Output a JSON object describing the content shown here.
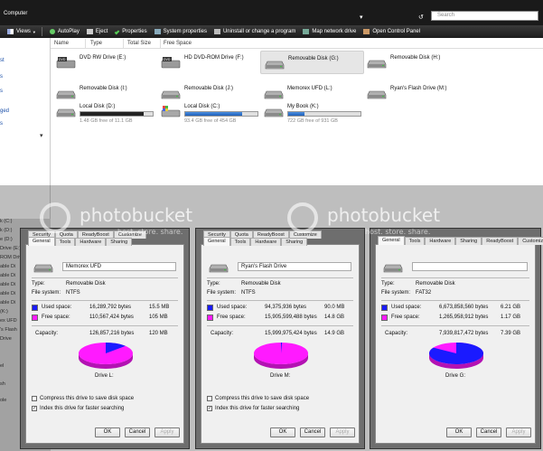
{
  "titlebar": {
    "breadcrumb": "Computer",
    "nav_up": "▾",
    "nav_back": "↺",
    "search_placeholder": "Search"
  },
  "toolbar": {
    "items": [
      "Views",
      "AutoPlay",
      "Eject",
      "Properties",
      "System properties",
      "Uninstall or change a program",
      "Map network drive",
      "Open Control Panel"
    ]
  },
  "leftpane": {
    "fragments": [
      "st",
      "s",
      "s",
      "ged",
      "s"
    ],
    "lower_items": [
      "k (C:)",
      "k (D:)",
      "e (D:)",
      "Drive (E:)",
      "ROM Drive (F:)",
      "able Di",
      "able Di",
      "able Di",
      "able Di",
      "able Di",
      "(K:)",
      "ex UFD",
      "'s Flash",
      "Drive",
      "el",
      "sh",
      "ole"
    ]
  },
  "columns": [
    "Name",
    "Type",
    "Total Size",
    "Free Space"
  ],
  "drives": [
    {
      "label": "DVD RW Drive (E:)",
      "icon": "dvd-drive-icon"
    },
    {
      "label": "HD DVD-ROM Drive (F:)",
      "icon": "dvd-drive-icon"
    },
    {
      "label": "Removable Disk (G:)",
      "icon": "removable-disk-icon",
      "selected": true
    },
    {
      "label": "Removable Disk (H:)",
      "icon": "removable-disk-icon"
    },
    {
      "label": "Removable Disk (I:)",
      "icon": "removable-disk-icon"
    },
    {
      "label": "Removable Disk (J:)",
      "icon": "removable-disk-icon"
    },
    {
      "label": "Memorex UFD (L:)",
      "icon": "removable-disk-icon"
    },
    {
      "label": "Ryan's Flash Drive (M:)",
      "icon": "removable-disk-icon"
    },
    {
      "label": "Local Disk (D:)",
      "icon": "hard-disk-icon",
      "free": "1.48 GB free of 11.1 GB",
      "used_fraction": 0.87
    },
    {
      "label": "Local Disk (C:)",
      "icon": "windows-disk-icon",
      "free": "93.4 GB free of 454 GB",
      "used_fraction": 0.79
    },
    {
      "label": "My Book (K:)",
      "icon": "hard-disk-icon",
      "free": "722 GB free of 931 GB",
      "used_fraction": 0.22
    }
  ],
  "dialogs": [
    {
      "tabs_top": [
        "Security",
        "Quota",
        "ReadyBoost",
        "Customize"
      ],
      "tabs": [
        "General",
        "Tools",
        "Hardware",
        "Sharing"
      ],
      "name": "Memorex UFD",
      "type_label": "Type:",
      "type": "Removable Disk",
      "fs_label": "File system:",
      "fs": "NTFS",
      "used_label": "Used space:",
      "used_bytes": "16,289,792 bytes",
      "used_h": "15.5 MB",
      "used_fraction": 0.13,
      "free_label": "Free space:",
      "free_bytes": "110,567,424 bytes",
      "free_h": "105 MB",
      "cap_label": "Capacity:",
      "cap_bytes": "126,857,216 bytes",
      "cap_h": "120 MB",
      "drive_caption": "Drive L:",
      "compress": "Compress this drive to save disk space",
      "index": "Index this drive for faster searching",
      "index_checked": true,
      "ok": "OK",
      "cancel": "Cancel",
      "apply": "Apply"
    },
    {
      "tabs_top": [
        "Security",
        "Quota",
        "ReadyBoost",
        "Customize"
      ],
      "tabs": [
        "General",
        "Tools",
        "Hardware",
        "Sharing"
      ],
      "name": "Ryan's Flash Drive",
      "type_label": "Type:",
      "type": "Removable Disk",
      "fs_label": "File system:",
      "fs": "NTFS",
      "used_label": "Used space:",
      "used_bytes": "94,375,936 bytes",
      "used_h": "90.0 MB",
      "used_fraction": 0.006,
      "free_label": "Free space:",
      "free_bytes": "15,905,599,488 bytes",
      "free_h": "14.8 GB",
      "cap_label": "Capacity:",
      "cap_bytes": "15,999,975,424 bytes",
      "cap_h": "14.9 GB",
      "drive_caption": "Drive M:",
      "compress": "Compress this drive to save disk space",
      "index": "Index this drive for faster searching",
      "index_checked": true,
      "ok": "OK",
      "cancel": "Cancel",
      "apply": "Apply"
    },
    {
      "tabs": [
        "General",
        "Tools",
        "Hardware",
        "Sharing",
        "ReadyBoost",
        "Customize"
      ],
      "name": "",
      "type_label": "Type:",
      "type": "Removable Disk",
      "fs_label": "File system:",
      "fs": "FAT32",
      "used_label": "Used space:",
      "used_bytes": "6,673,858,560 bytes",
      "used_h": "6.21 GB",
      "used_fraction": 0.84,
      "free_label": "Free space:",
      "free_bytes": "1,265,958,912 bytes",
      "free_h": "1.17 GB",
      "cap_label": "Capacity:",
      "cap_bytes": "7,939,817,472 bytes",
      "cap_h": "7.39 GB",
      "drive_caption": "Drive G:",
      "ok": "OK",
      "cancel": "Cancel",
      "apply": "Apply"
    }
  ],
  "colors": {
    "used": "#1a1aff",
    "free": "#ff1aff",
    "accent": "#1e5fb8"
  },
  "watermark": {
    "brand": "photobucket",
    "tagline": "host. store. share."
  }
}
